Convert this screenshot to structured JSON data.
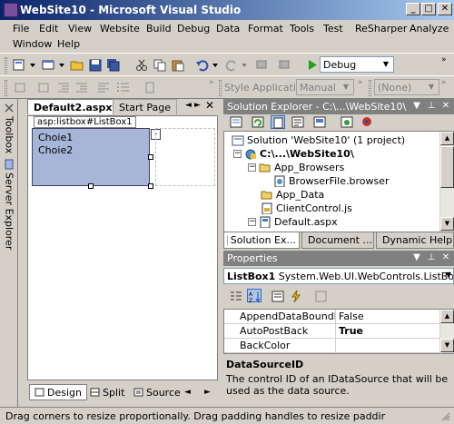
{
  "window": {
    "title": "WebSite10 - Microsoft Visual Studio"
  },
  "menu": [
    "File",
    "Edit",
    "View",
    "Website",
    "Build",
    "Debug",
    "Data",
    "Format",
    "Tools",
    "Test",
    "ReSharper",
    "Analyze",
    "Window",
    "Help"
  ],
  "toolbar": {
    "config_value": "Debug",
    "style_app_label": "Style Application:",
    "style_app_value": "Manual",
    "none_value": "(None)"
  },
  "sidebar": {
    "toolbox": "Toolbox",
    "server_explorer": "Server Explorer"
  },
  "document": {
    "tabs": [
      "Default2.aspx*",
      "Start Page"
    ],
    "control_tag": "asp:listbox#ListBox1",
    "listbox_items": [
      "Choie1",
      "Choie2"
    ],
    "smart_tag": "›",
    "view_tabs": [
      "Design",
      "Split",
      "Source"
    ]
  },
  "solution_explorer": {
    "title": "Solution Explorer - C:\\...\\WebSite10\\",
    "tree": [
      {
        "label": "Solution 'WebSite10' (1 project)"
      },
      {
        "label": "C:\\...\\WebSite10\\"
      },
      {
        "label": "App_Browsers"
      },
      {
        "label": "BrowserFile.browser"
      },
      {
        "label": "App_Data"
      },
      {
        "label": "ClientControl.js"
      },
      {
        "label": "Default.aspx"
      }
    ],
    "tabs": [
      "Solution Ex...",
      "Document ...",
      "Dynamic Help"
    ]
  },
  "properties": {
    "title": "Properties",
    "object_name": "ListBox1",
    "object_type": "System.Web.UI.WebControls.ListBox",
    "rows": [
      {
        "name": "AppendDataBoundItem",
        "value": "False"
      },
      {
        "name": "AutoPostBack",
        "value": "True"
      },
      {
        "name": "BackColor",
        "value": ""
      }
    ],
    "desc_title": "DataSourceID",
    "desc_text": "The control ID of an IDataSource that will be used as the data source."
  },
  "status": {
    "text": "Drag corners to resize proportionally. Drag padding handles to resize paddir"
  },
  "colors": {
    "title_start": "#0a246a",
    "title_end": "#a6caf0",
    "selection": "#316ac5",
    "listbox_fill": "#a6b5d8"
  }
}
